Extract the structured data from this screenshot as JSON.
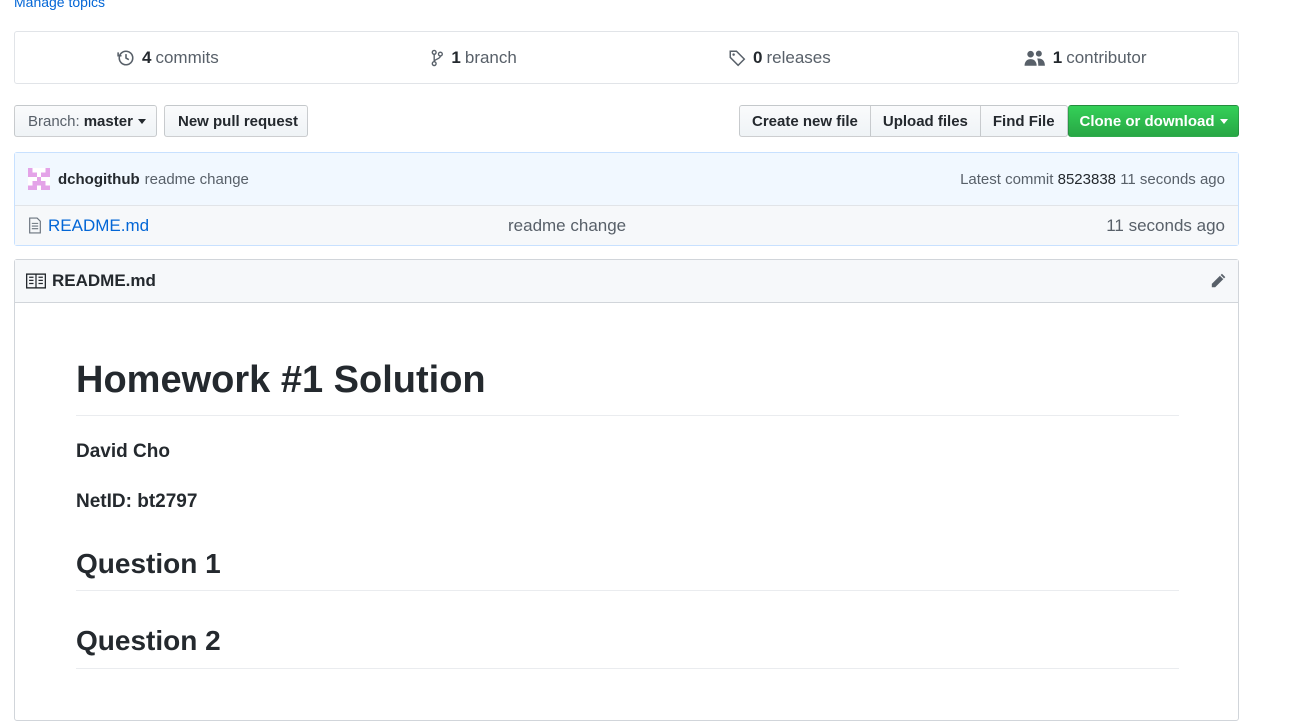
{
  "manage_topics": "Manage topics",
  "summary": {
    "commits": {
      "num": "4",
      "label": "commits"
    },
    "branches": {
      "num": "1",
      "label": "branch"
    },
    "releases": {
      "num": "0",
      "label": "releases"
    },
    "contributors": {
      "num": "1",
      "label": "contributor"
    }
  },
  "toolbar": {
    "branch_prefix": "Branch:",
    "branch_name": "master",
    "new_pr": "New pull request",
    "create_file": "Create new file",
    "upload_files": "Upload files",
    "find_file": "Find File",
    "clone": "Clone or download"
  },
  "commit": {
    "author": "dchogithub",
    "message": "readme change",
    "latest_label": "Latest commit",
    "sha": "8523838",
    "age": "11 seconds ago"
  },
  "files": [
    {
      "name": "README.md",
      "message": "readme change",
      "age": "11 seconds ago"
    }
  ],
  "readme": {
    "filename": "README.md",
    "h1": "Homework #1 Solution",
    "author_line": "David Cho",
    "netid_line": "NetID: bt2797",
    "q1": "Question 1",
    "q2": "Question 2"
  },
  "colors": {
    "link": "#0366d6",
    "clone_button": "#28a745",
    "avatar": "#e4a3e8"
  }
}
